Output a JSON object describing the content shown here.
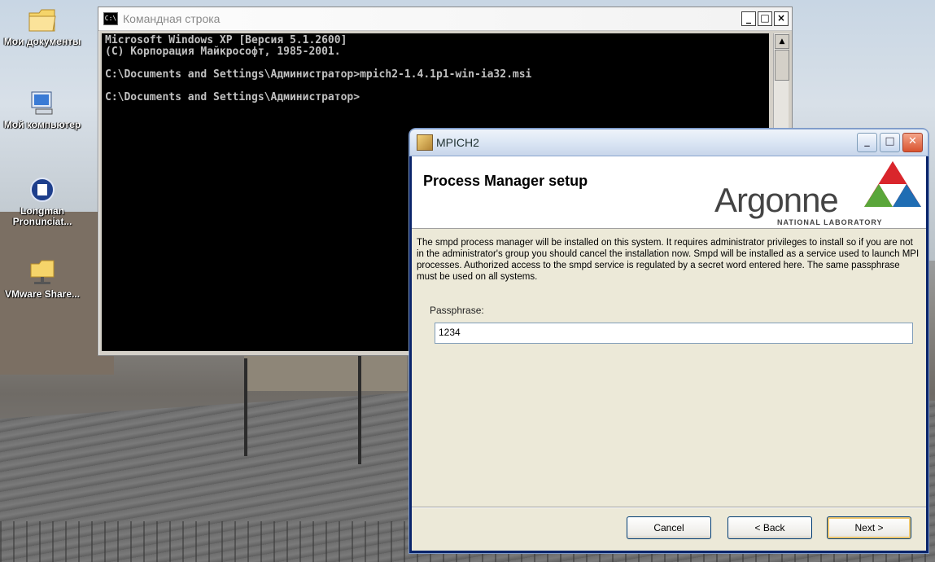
{
  "desktop": {
    "icons": [
      {
        "label": "Мои документы",
        "icon": "folder-icon"
      },
      {
        "label": "Мой компьютер",
        "icon": "computer-icon"
      },
      {
        "label": "Longman Pronunciat...",
        "icon": "globe-icon"
      },
      {
        "label": "VMware Share...",
        "icon": "network-folder-icon"
      }
    ]
  },
  "cmd": {
    "title": "Командная строка",
    "lines": [
      "Microsoft Windows XP [Версия 5.1.2600]",
      "(С) Корпорация Майкрософт, 1985-2001.",
      "",
      "C:\\Documents and Settings\\Администратор>mpich2-1.4.1p1-win-ia32.msi",
      "",
      "C:\\Documents and Settings\\Администратор>"
    ],
    "buttons": {
      "minimize": "_",
      "maximize": "□",
      "close": "×"
    }
  },
  "dialog": {
    "title": "MPICH2",
    "heading": "Process Manager setup",
    "logo_text": "Argonne",
    "logo_sub": "NATIONAL LABORATORY",
    "description": "The smpd process manager will be installed on this system.  It requires administrator privileges to install so if you are not in the administrator's group you should cancel the installation now.  Smpd will be installed as a service used to launch MPI processes.  Authorized access to the smpd service is regulated by a secret word entered here.  The same passphrase must be used on all systems.",
    "passphrase_label": "Passphrase:",
    "passphrase_value": "1234",
    "buttons": {
      "cancel": "Cancel",
      "back": "< Back",
      "next": "Next >"
    },
    "colors": {
      "accent": "#0a246a",
      "logo_red": "#d9262c",
      "logo_green": "#5aa63a",
      "logo_blue": "#1f6db3"
    }
  }
}
